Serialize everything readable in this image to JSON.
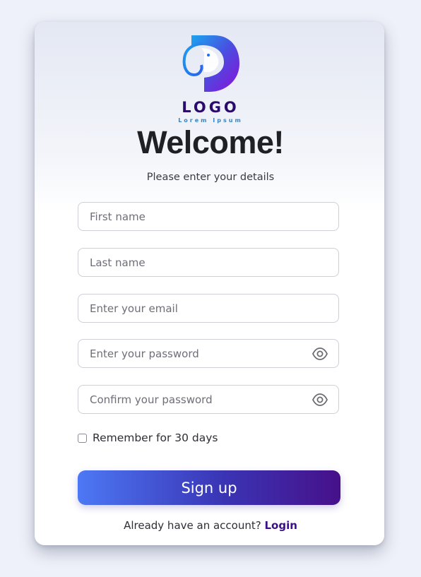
{
  "brand": {
    "logo_text": "LOGO",
    "logo_tagline": "Lorem Ipsum",
    "logo_icon": "elephant-d-logo-icon"
  },
  "header": {
    "title": "Welcome!",
    "subtitle": "Please enter your details"
  },
  "form": {
    "first_name": {
      "placeholder": "First name",
      "value": ""
    },
    "last_name": {
      "placeholder": "Last name",
      "value": ""
    },
    "email": {
      "placeholder": "Enter your email",
      "value": ""
    },
    "password": {
      "placeholder": "Enter your password",
      "value": "",
      "toggle_icon": "eye-icon"
    },
    "confirm_password": {
      "placeholder": "Confirm your password",
      "value": "",
      "toggle_icon": "eye-icon"
    },
    "remember": {
      "label": "Remember for 30 days",
      "checked": false
    },
    "submit_label": "Sign up"
  },
  "footer": {
    "prompt": "Already have an account?",
    "login_label": "Login"
  },
  "colors": {
    "page_bg": "#eef1f9",
    "accent_start": "#4d78f5",
    "accent_end": "#47108a",
    "title": "#1f1f24",
    "link": "#3b0f8a"
  }
}
